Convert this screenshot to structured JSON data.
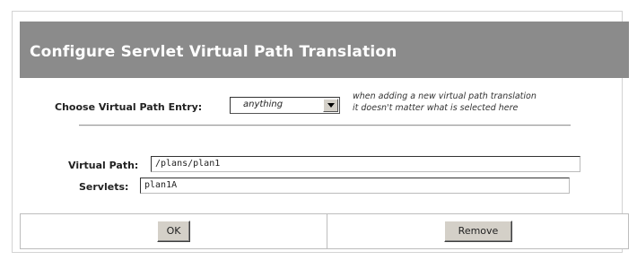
{
  "header": {
    "title": "Configure Servlet Virtual Path Translation"
  },
  "choose_entry": {
    "label": "Choose Virtual Path Entry:",
    "selected": "anything",
    "hint_line1": "when adding a new virtual path translation",
    "hint_line2": "it doesn't matter what is selected here"
  },
  "fields": {
    "virtual_path_label": "Virtual Path:",
    "virtual_path_value": "/plans/plan1",
    "servlets_label": "Servlets:",
    "servlets_value": "plan1A"
  },
  "buttons": {
    "ok_label": "OK",
    "remove_label": "Remove"
  },
  "colors": {
    "title_bar": "#8b8b8b",
    "button_face": "#d4d0c8"
  }
}
